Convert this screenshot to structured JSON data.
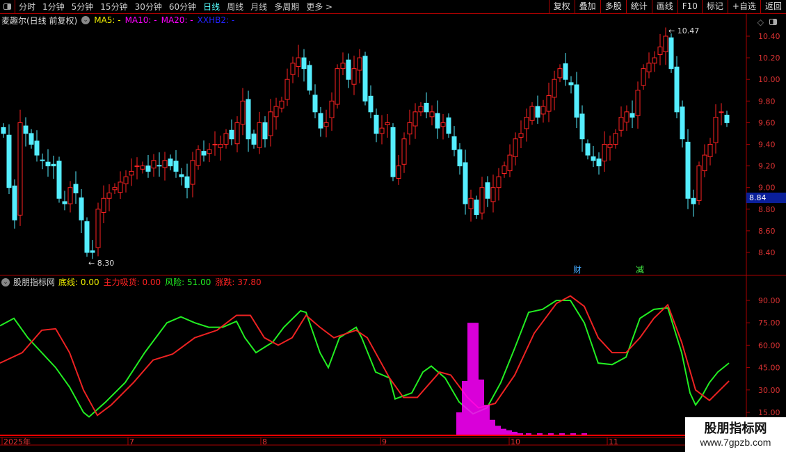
{
  "menu": {
    "items": [
      "分时",
      "1分钟",
      "5分钟",
      "15分钟",
      "30分钟",
      "60分钟",
      "日线",
      "周线",
      "月线",
      "多周期",
      "更多 >"
    ],
    "active": "日线",
    "right": [
      "复权",
      "叠加",
      "多股",
      "统计",
      "画线",
      "F10",
      "标记",
      "+自选",
      "返回"
    ]
  },
  "main": {
    "stock": "麦趣尔(日线 前复权)",
    "ma5": "MA5: -",
    "ma10": "MA10: -",
    "ma20": "MA20: -",
    "xxhb2": "XXHB2: -",
    "high_label": "10.47",
    "low_label": "8.30",
    "current_price": "8.84",
    "markers": [
      {
        "text": "财",
        "color": "#4af"
      },
      {
        "text": "减",
        "color": "#4e4"
      }
    ]
  },
  "sub": {
    "name": "股朋指标网",
    "fields": [
      {
        "label": "底线: 0.00",
        "color": "#ee0"
      },
      {
        "label": "主力吸货: 0.00",
        "color": "#f22"
      },
      {
        "label": "风险: 51.00",
        "color": "#2e2"
      },
      {
        "label": "涨跌: 37.80",
        "color": "#f22"
      }
    ]
  },
  "dates": [
    "2025年",
    "7",
    "8",
    "9",
    "10",
    "11"
  ],
  "watermark": {
    "title": "股朋指标网",
    "url": "www.7gpzb.com"
  },
  "chart_data": [
    {
      "type": "candlestick",
      "title": "麦趣尔 日线",
      "yticks": [
        8.4,
        8.6,
        8.8,
        9.0,
        9.2,
        9.4,
        9.6,
        9.8,
        10.0,
        10.2,
        10.4
      ],
      "ylim": [
        8.2,
        10.6
      ],
      "closes": [
        9.5,
        9.0,
        8.7,
        9.6,
        9.5,
        9.4,
        9.3,
        9.25,
        9.2,
        9.2,
        8.9,
        8.85,
        9.0,
        8.95,
        8.7,
        8.4,
        8.4,
        8.8,
        8.9,
        8.95,
        9.0,
        9.05,
        9.1,
        9.15,
        9.2,
        9.2,
        9.15,
        9.25,
        9.2,
        9.25,
        9.2,
        9.15,
        9.1,
        9.0,
        9.25,
        9.35,
        9.3,
        9.35,
        9.4,
        9.4,
        9.5,
        9.45,
        9.6,
        9.8,
        9.45,
        9.4,
        9.6,
        9.45,
        9.7,
        9.75,
        9.8,
        10.0,
        10.15,
        10.2,
        10.1,
        9.9,
        9.7,
        9.55,
        9.6,
        9.8,
        10.1,
        10.15,
        10.0,
        10.1,
        10.2,
        9.8,
        9.7,
        9.5,
        9.55,
        9.6,
        9.1,
        9.2,
        9.45,
        9.6,
        9.7,
        9.75,
        9.7,
        9.7,
        9.55,
        9.6,
        9.5,
        9.35,
        9.2,
        8.85,
        8.9,
        8.75,
        9.0,
        8.9,
        9.0,
        9.1,
        9.2,
        9.3,
        9.45,
        9.5,
        9.65,
        9.75,
        9.65,
        9.75,
        9.85,
        10.0,
        10.1,
        10.0,
        9.95,
        9.65,
        9.45,
        9.3,
        9.25,
        9.2,
        9.4,
        9.4,
        9.5,
        9.65,
        9.7,
        9.65,
        9.9,
        10.1,
        10.15,
        10.2,
        10.3,
        10.4,
        10.1,
        9.7,
        9.45,
        8.9,
        8.85,
        9.2,
        9.3,
        9.4,
        9.65,
        9.7,
        9.6
      ]
    },
    {
      "type": "line",
      "title": "股朋指标网",
      "yticks": [
        15,
        30,
        45,
        60,
        75,
        90
      ],
      "ylim": [
        0,
        100
      ],
      "series": [
        {
          "name": "风险",
          "color": "#2e2",
          "points": [
            [
              0,
              73
            ],
            [
              2.5,
              78
            ],
            [
              5,
              65
            ],
            [
              7.5,
              55
            ],
            [
              10,
              45
            ],
            [
              12.5,
              32
            ],
            [
              15,
              15
            ],
            [
              16,
              12
            ],
            [
              19,
              22
            ],
            [
              22.5,
              35
            ],
            [
              26,
              55
            ],
            [
              30,
              75
            ],
            [
              32.5,
              79
            ],
            [
              35,
              75
            ],
            [
              37.5,
              72
            ],
            [
              40,
              72
            ],
            [
              42.5,
              76
            ],
            [
              44,
              65
            ],
            [
              46,
              55
            ],
            [
              49,
              62
            ],
            [
              51,
              72
            ],
            [
              54,
              83
            ],
            [
              55,
              82
            ],
            [
              57.5,
              55
            ],
            [
              59,
              45
            ],
            [
              61,
              65
            ],
            [
              64,
              72
            ],
            [
              65,
              65
            ],
            [
              67.5,
              42
            ],
            [
              70,
              38
            ],
            [
              71,
              24
            ],
            [
              74,
              28
            ],
            [
              76,
              42
            ],
            [
              77.5,
              46
            ],
            [
              80,
              38
            ],
            [
              82.5,
              22
            ],
            [
              85,
              14
            ],
            [
              87.5,
              18
            ],
            [
              90,
              35
            ],
            [
              92.5,
              58
            ],
            [
              95,
              82
            ],
            [
              97.5,
              84
            ],
            [
              100,
              90
            ],
            [
              102.5,
              90
            ],
            [
              105,
              75
            ],
            [
              107.5,
              48
            ],
            [
              110,
              47
            ],
            [
              112.5,
              52
            ],
            [
              115,
              78
            ],
            [
              117.5,
              84
            ],
            [
              120,
              85
            ],
            [
              122.5,
              55
            ],
            [
              124,
              28
            ],
            [
              125,
              20
            ],
            [
              126,
              25
            ],
            [
              127.5,
              35
            ],
            [
              129,
              42
            ],
            [
              131,
              48
            ]
          ]
        },
        {
          "name": "涨跌",
          "color": "#e22",
          "points": [
            [
              0,
              48
            ],
            [
              4,
              55
            ],
            [
              7.5,
              70
            ],
            [
              10,
              71
            ],
            [
              12.5,
              55
            ],
            [
              15,
              30
            ],
            [
              17.5,
              13
            ],
            [
              20,
              20
            ],
            [
              24,
              35
            ],
            [
              27.5,
              50
            ],
            [
              31,
              54
            ],
            [
              35,
              65
            ],
            [
              39,
              70
            ],
            [
              42.5,
              80
            ],
            [
              45,
              80
            ],
            [
              47.5,
              65
            ],
            [
              50,
              60
            ],
            [
              52.5,
              65
            ],
            [
              55,
              80
            ],
            [
              57.5,
              72
            ],
            [
              60,
              65
            ],
            [
              64,
              70
            ],
            [
              66,
              65
            ],
            [
              70,
              38
            ],
            [
              72.5,
              25
            ],
            [
              75,
              25
            ],
            [
              79,
              42
            ],
            [
              81,
              40
            ],
            [
              84,
              25
            ],
            [
              86,
              18
            ],
            [
              89,
              21
            ],
            [
              92.5,
              40
            ],
            [
              96,
              68
            ],
            [
              100,
              88
            ],
            [
              102.5,
              93
            ],
            [
              105,
              86
            ],
            [
              107.5,
              65
            ],
            [
              110,
              55
            ],
            [
              112.5,
              55
            ],
            [
              115,
              65
            ],
            [
              117.5,
              78
            ],
            [
              120,
              87
            ],
            [
              122.5,
              62
            ],
            [
              125,
              30
            ],
            [
              127.5,
              23
            ],
            [
              131,
              36
            ]
          ]
        },
        {
          "name": "主力吸货",
          "color": "#f0f",
          "type": "bar",
          "points": [
            [
              82.5,
              15
            ],
            [
              83.5,
              36
            ],
            [
              84.5,
              75
            ],
            [
              85.5,
              75
            ],
            [
              86.5,
              37
            ],
            [
              87.5,
              20
            ],
            [
              88.5,
              10
            ],
            [
              89.5,
              6
            ],
            [
              90.5,
              4
            ],
            [
              91.5,
              3
            ],
            [
              92.5,
              2
            ],
            [
              93.5,
              1
            ],
            [
              95,
              1
            ],
            [
              97,
              1
            ],
            [
              99,
              1
            ],
            [
              101,
              1
            ],
            [
              103,
              1
            ],
            [
              105,
              1
            ]
          ]
        }
      ]
    }
  ]
}
